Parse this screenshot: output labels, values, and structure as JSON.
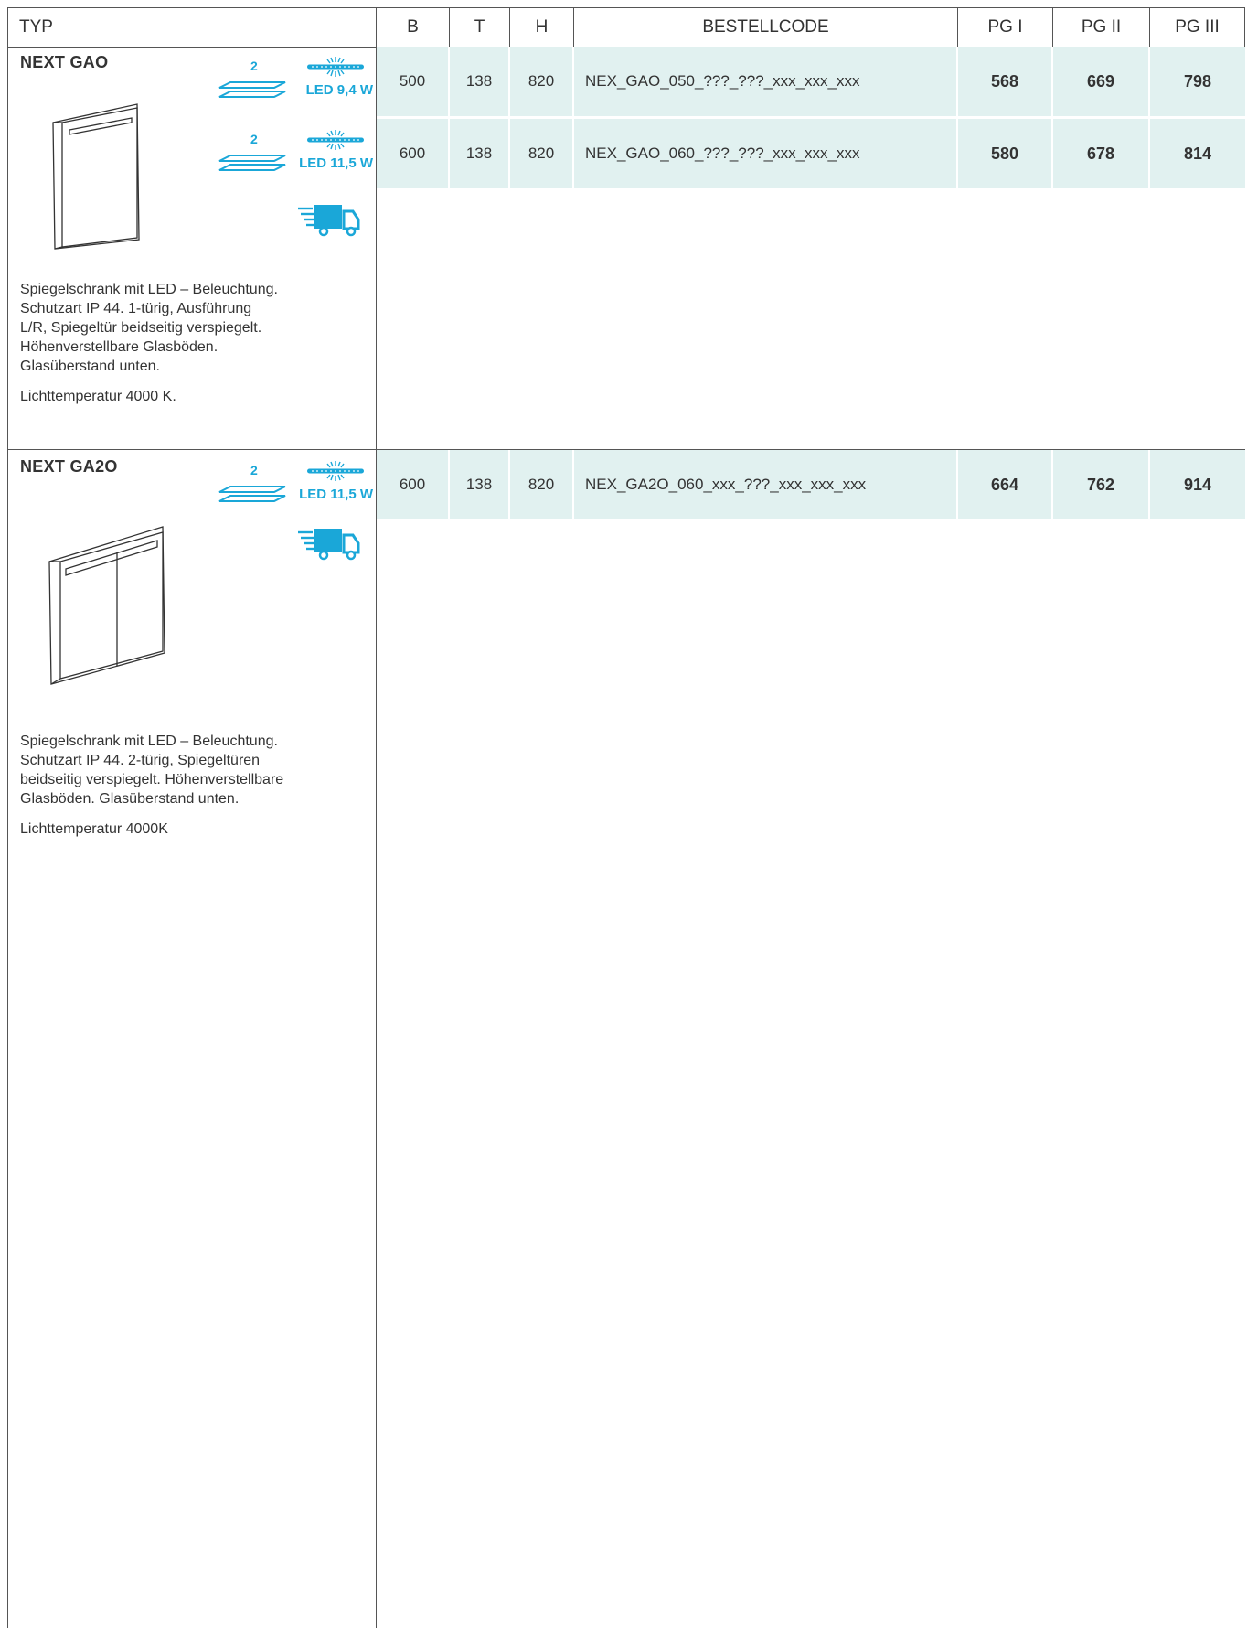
{
  "header": {
    "typ": "TYP",
    "b": "B",
    "t": "T",
    "h": "H",
    "code": "BESTELLCODE",
    "pg1": "PG I",
    "pg2": "PG II",
    "pg3": "PG III"
  },
  "products": [
    {
      "title": "NEXT GAO",
      "badges": [
        {
          "shelves": "2",
          "led": "LED 9,4 W"
        },
        {
          "shelves": "2",
          "led": "LED 11,5 W"
        }
      ],
      "description": "Spiegelschrank mit LED – Beleuchtung. Schutzart IP 44. 1-türig, Ausführung L/R, Spiegeltür beidseitig verspiegelt. Höhenverstellbare Glasböden. Glasüberstand unten.",
      "desc_lines": [
        "Spiegelschrank mit LED – Beleuchtung.",
        "Schutzart IP 44. 1-türig, Ausführung",
        "L/R, Spiegeltür beidseitig verspiegelt.",
        "Höhenverstellbare Glasböden.",
        "Glasüberstand unten."
      ],
      "temperature": "Lichttemperatur 4000 K.",
      "rows": [
        {
          "b": "500",
          "t": "138",
          "h": "820",
          "code": "NEX_GAO_050_???_???_xxx_xxx_xxx",
          "pg1": "568",
          "pg2": "669",
          "pg3": "798"
        },
        {
          "b": "600",
          "t": "138",
          "h": "820",
          "code": "NEX_GAO_060_???_???_xxx_xxx_xxx",
          "pg1": "580",
          "pg2": "678",
          "pg3": "814"
        }
      ]
    },
    {
      "title": "NEXT GA2O",
      "badges": [
        {
          "shelves": "2",
          "led": "LED 11,5 W"
        }
      ],
      "desc_lines": [
        "Spiegelschrank mit LED – Beleuchtung.",
        "Schutzart IP 44. 2-türig, Spiegeltüren",
        "beidseitig verspiegelt. Höhenverstellbare",
        "Glasböden. Glasüberstand unten."
      ],
      "temperature": "Lichttemperatur  4000K",
      "rows": [
        {
          "b": "600",
          "t": "138",
          "h": "820",
          "code": "NEX_GA2O_060_xxx_???_xxx_xxx_xxx",
          "pg1": "664",
          "pg2": "762",
          "pg3": "914"
        }
      ]
    }
  ],
  "colors": {
    "accent": "#1aa7d8",
    "row_bg": "#e1f1f0",
    "rule": "#555555"
  }
}
